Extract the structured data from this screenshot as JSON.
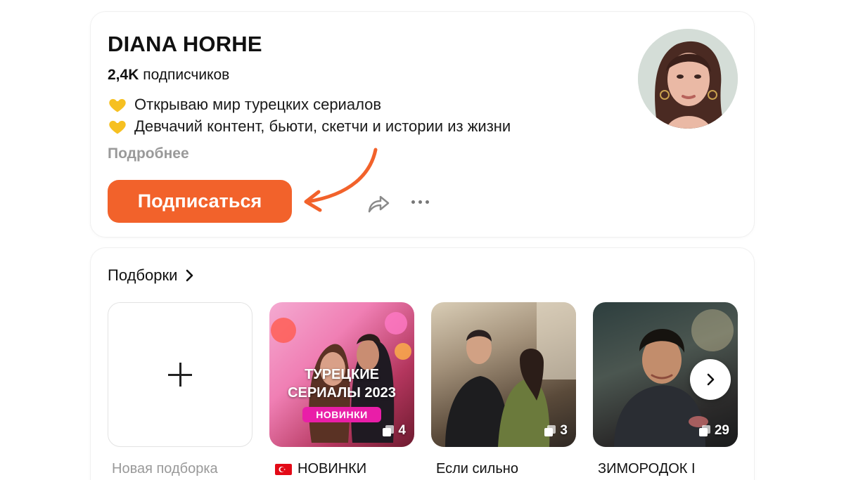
{
  "profile": {
    "name": "DIANA HORHE",
    "subscribers_count": "2,4K",
    "subscribers_label": "подписчиков",
    "description_lines": [
      "Открываю мир турецких сериалов",
      "Девчачий контент, бьюти, скетчи и истории из жизни"
    ],
    "more_link": "Подробнее",
    "subscribe_button": "Подписаться",
    "accent_color": "#f2622b"
  },
  "collections": {
    "title": "Подборки",
    "new_collection_caption": "Новая подборка",
    "items": [
      {
        "cover_title_line1": "ТУРЕЦКИЕ",
        "cover_title_line2": "СЕРИАЛЫ 2023",
        "cover_badge": "НОВИНКИ",
        "count": "4",
        "caption": "НОВИНКИ"
      },
      {
        "count": "3",
        "caption": "Если сильно"
      },
      {
        "count": "29",
        "caption": "ЗИМОРОДОК I"
      }
    ]
  }
}
